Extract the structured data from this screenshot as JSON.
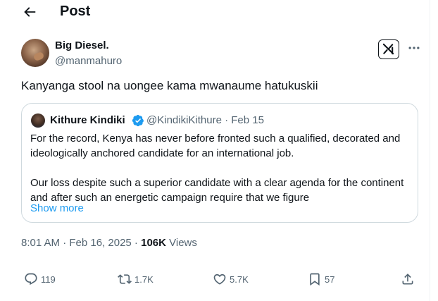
{
  "header": {
    "title": "Post"
  },
  "author": {
    "name": "Big Diesel.",
    "handle": "@manmahuro"
  },
  "tweet": {
    "text": "Kanyanga stool na uongee kama mwanaume hatukuskii"
  },
  "quote": {
    "name": "Kithure Kindiki",
    "handle_date": "@KindikiKithure · Feb 15",
    "paragraphs": [
      "For the record, Kenya has never before fronted such a qualified, decorated and ideologically anchored candidate for an international job.",
      "Our loss despite such a superior candidate with a clear agenda for the continent and after such an energetic campaign require that we figure"
    ],
    "show_more": "Show more",
    "verified_color": "#1d9bf0"
  },
  "meta": {
    "timestamp": "8:01 AM · Feb 16, 2025 · ",
    "views_count": "106K",
    "views_label": " Views"
  },
  "actions": {
    "replies": "119",
    "reposts": "1.7K",
    "likes": "5.7K",
    "bookmarks": "57"
  },
  "colors": {
    "accent": "#1d9bf0",
    "text": "#0f1419",
    "muted": "#536471"
  }
}
